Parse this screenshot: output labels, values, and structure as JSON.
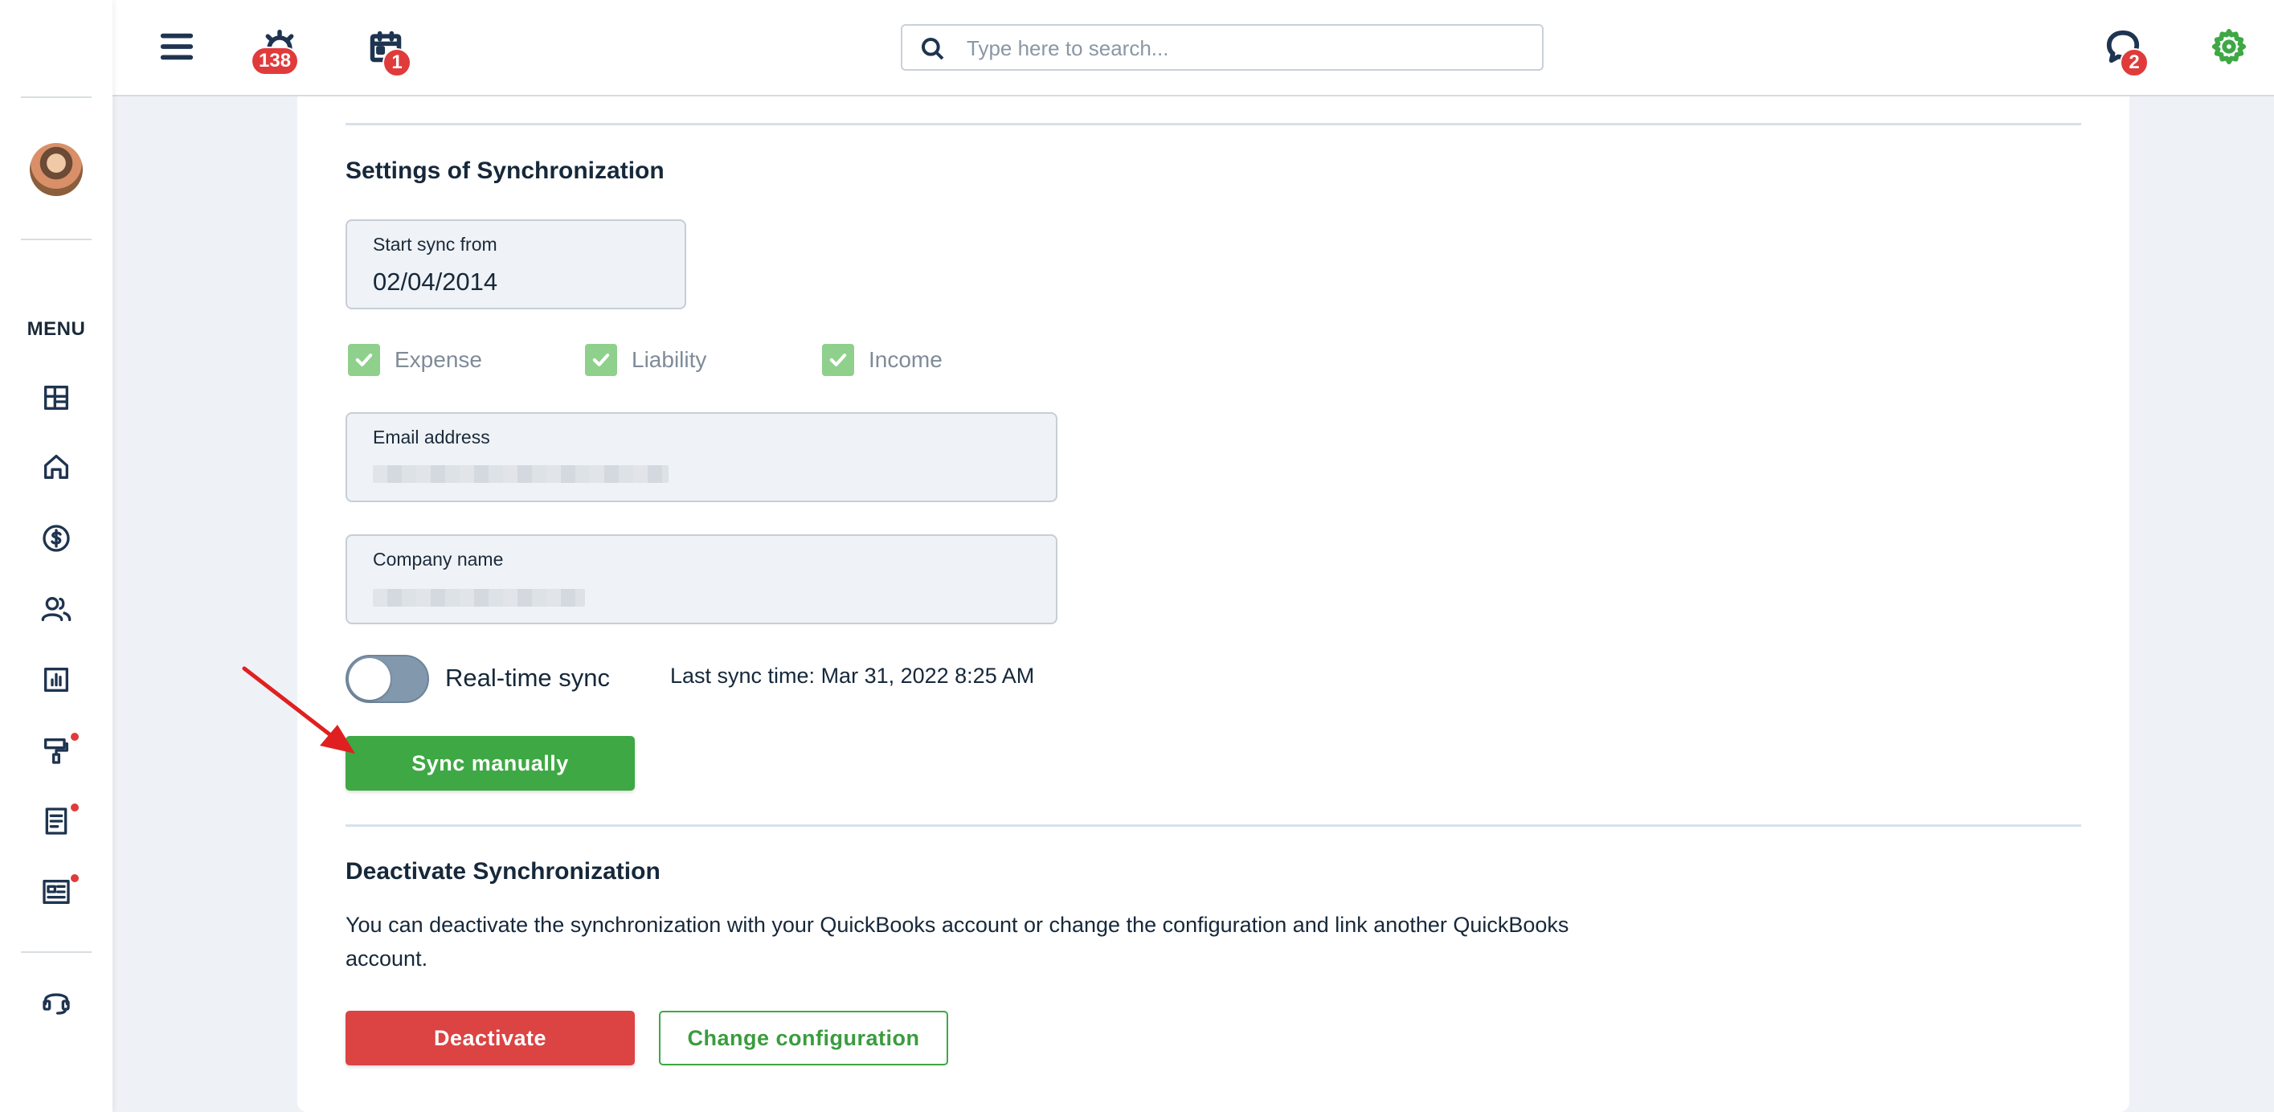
{
  "topbar": {
    "alarm_badge": "138",
    "calendar_badge": "1",
    "search_placeholder": "Type here to search...",
    "chat_badge": "2",
    "settings_color": "#3ea844"
  },
  "sidebar": {
    "menu_label": "MENU",
    "icons": [
      "dashboard-icon",
      "home-icon",
      "dollar-icon",
      "users-icon",
      "chart-icon",
      "paint-roller-icon",
      "document-icon",
      "newspaper-icon",
      "headset-icon"
    ]
  },
  "sync_settings": {
    "title": "Settings of Synchronization",
    "start_sync_label": "Start sync from",
    "start_sync_value": "02/04/2014",
    "checkboxes": [
      {
        "label": "Expense",
        "checked": true
      },
      {
        "label": "Liability",
        "checked": true
      },
      {
        "label": "Income",
        "checked": true
      }
    ],
    "email_label": "Email address",
    "company_label": "Company name",
    "realtime_label": "Real-time sync",
    "realtime_on": false,
    "last_sync": "Last sync time: Mar 31, 2022 8:25 AM",
    "sync_button": "Sync manually"
  },
  "deactivate": {
    "title": "Deactivate Synchronization",
    "description": "You can deactivate the synchronization with your QuickBooks account or change the configuration and link another QuickBooks account.",
    "deactivate_button": "Deactivate",
    "change_button": "Change configuration"
  },
  "colors": {
    "accent_green": "#3ea844",
    "danger_red": "#dc4343",
    "badge_red": "#e03b3b",
    "annotation_arrow": "#e02020"
  }
}
